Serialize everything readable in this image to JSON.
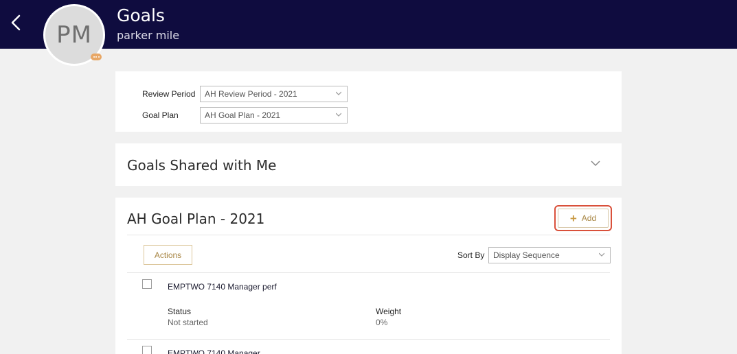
{
  "header": {
    "title": "Goals",
    "subtitle": "parker mile",
    "avatar_initials": "PM",
    "background_color": "#0f0c3f"
  },
  "filters": {
    "review_period_label": "Review Period",
    "review_period_value": "AH Review Period - 2021",
    "goal_plan_label": "Goal Plan",
    "goal_plan_value": "AH Goal Plan - 2021"
  },
  "shared_section": {
    "title": "Goals Shared with Me",
    "icon": "chevron-down-icon"
  },
  "goal_plan_section": {
    "title": "AH Goal Plan - 2021",
    "add_label": "Add",
    "actions_label": "Actions",
    "sort_by_label": "Sort By",
    "sort_by_value": "Display Sequence",
    "goals": [
      {
        "name": "EMPTWO 7140 Manager perf",
        "status_label": "Status",
        "status_value": "Not started",
        "weight_label": "Weight",
        "weight_value": "0%"
      },
      {
        "name": "EMPTWO 7140 Manager"
      }
    ]
  },
  "accent_color": "#a88644",
  "highlight_color": "#d9503a"
}
